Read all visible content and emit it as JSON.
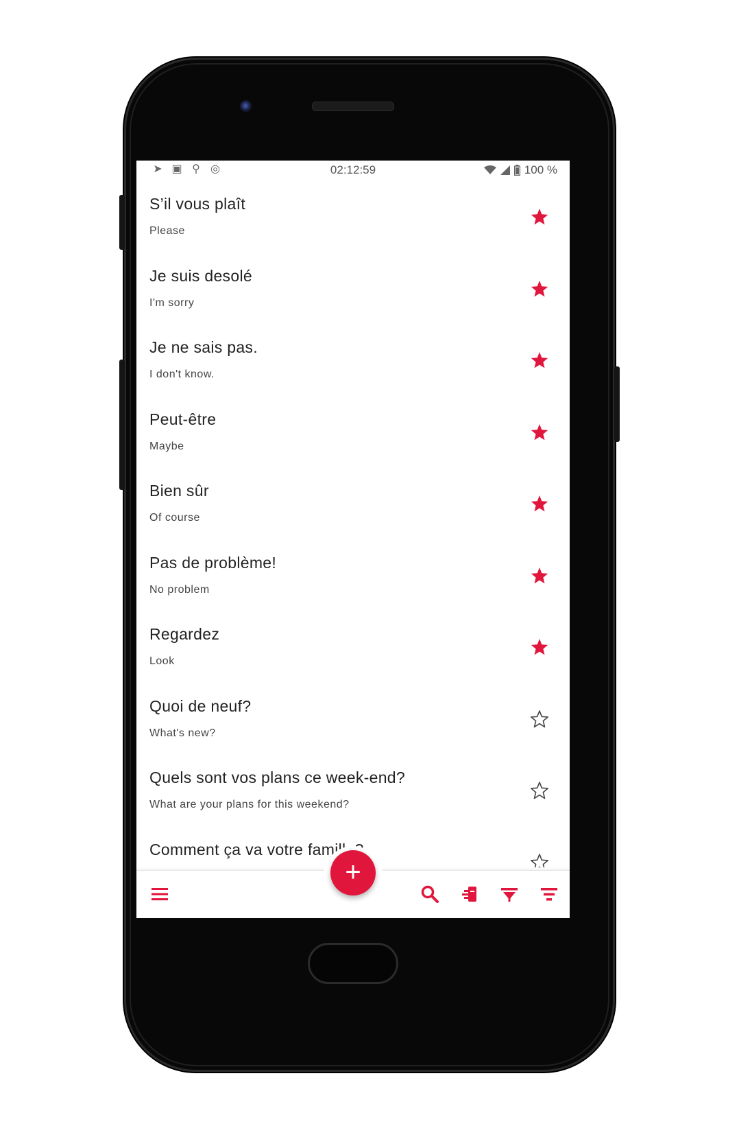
{
  "status_bar": {
    "time": "02:12:59",
    "battery": "100 %"
  },
  "phrases": [
    {
      "title": "S’il vous plaît",
      "translation": "Please",
      "starred": true
    },
    {
      "title": "Je suis desolé",
      "translation": "I'm sorry",
      "starred": true
    },
    {
      "title": "Je ne sais pas.",
      "translation": "I don't know.",
      "starred": true
    },
    {
      "title": "Peut-être",
      "translation": "Maybe",
      "starred": true
    },
    {
      "title": "Bien sûr",
      "translation": "Of course",
      "starred": true
    },
    {
      "title": "Pas de problème!",
      "translation": "No problem",
      "starred": true
    },
    {
      "title": "Regardez",
      "translation": "Look",
      "starred": true
    },
    {
      "title": "Quoi de neuf?",
      "translation": "What's new?",
      "starred": false
    },
    {
      "title": "Quels sont vos plans ce week-end?",
      "translation": "What are your plans for this weekend?",
      "starred": false
    },
    {
      "title": "Comment ça va votre famille?",
      "translation": "",
      "starred": false
    }
  ],
  "fab": {
    "label": "+"
  },
  "icons": {
    "menu": "menu-icon",
    "search": "search-icon",
    "cards": "flashcards-icon",
    "filter": "filter-icon",
    "sort": "sort-icon",
    "star_filled": "star-filled-icon",
    "star_outline": "star-outline-icon"
  },
  "colors": {
    "accent": "#e1163c",
    "outline_star": "#444444"
  }
}
